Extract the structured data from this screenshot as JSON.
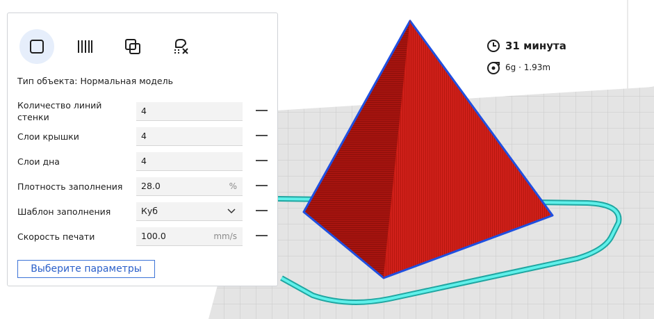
{
  "panel": {
    "object_type": "Тип объекта: Нормальная модель",
    "mode_icons": [
      "normal-model-icon",
      "support-mesh-icon",
      "overlap-mesh-icon",
      "support-blocker-icon"
    ],
    "settings": [
      {
        "label": "Количество линий\nстенки",
        "value": "4",
        "unit": ""
      },
      {
        "label": "Слои крышки",
        "value": "4",
        "unit": ""
      },
      {
        "label": "Слои дна",
        "value": "4",
        "unit": ""
      },
      {
        "label": "Плотность заполнения",
        "value": "28.0",
        "unit": "%"
      },
      {
        "label": "Шаблон заполнения",
        "value": "Куб",
        "unit": ""
      },
      {
        "label": "Скорость печати",
        "value": "100.0",
        "unit": "mm/s"
      }
    ],
    "select_button_label": "Выберите параметры"
  },
  "print_info": {
    "time": "31 минута",
    "material": "6g · 1.93m"
  },
  "colors": {
    "accent": "#3c73d7",
    "model_red": "#c41b14",
    "model_outline": "#1f4fe0",
    "skirt": "#2fd6d0",
    "build_plate": "#e6e6e6"
  }
}
